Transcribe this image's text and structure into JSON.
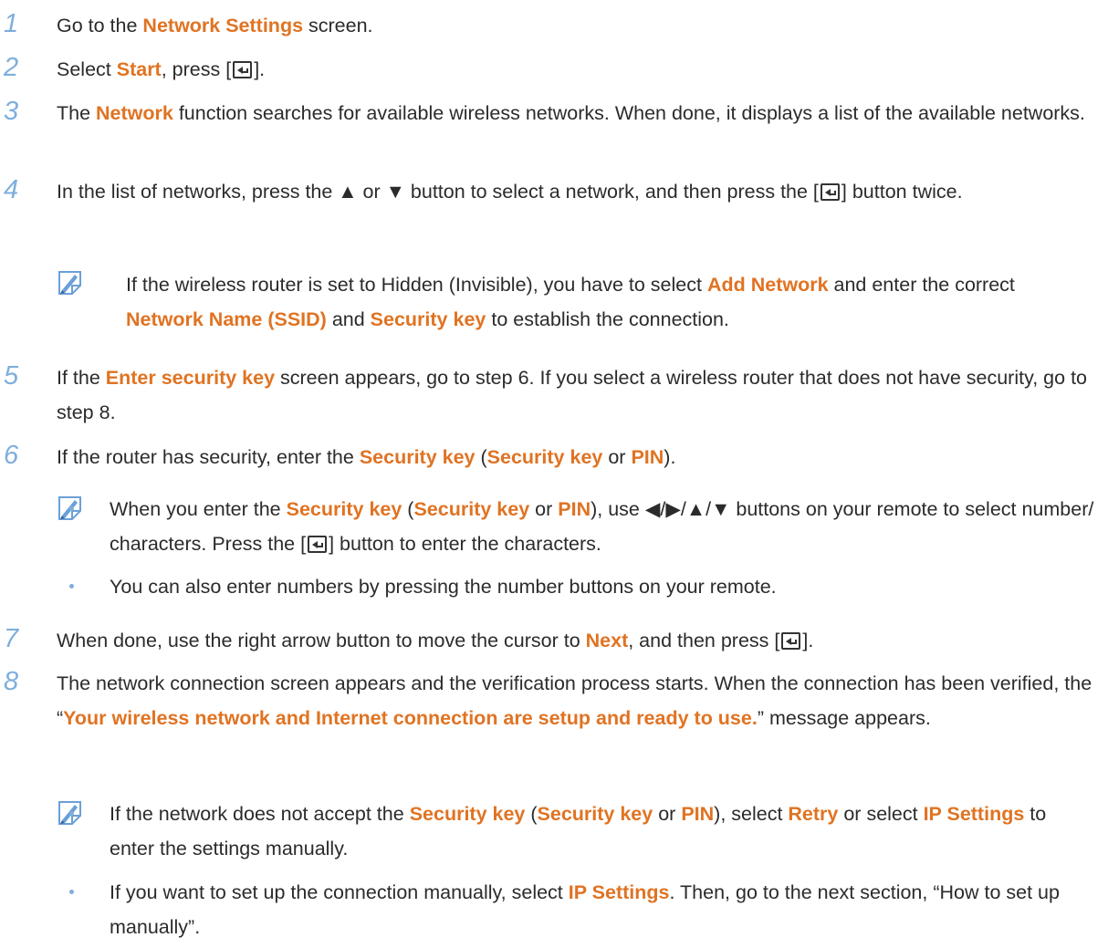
{
  "steps": [
    {
      "num": "1",
      "a": "Go to the ",
      "h1": "Network Settings",
      "b": " screen."
    },
    {
      "num": "2",
      "a": "Select ",
      "h1": "Start",
      "b": ", press [",
      "c": "]."
    },
    {
      "num": "3",
      "a": "The ",
      "h1": "Network",
      "b": " function searches for available wireless networks. When done, it displays a list of the available networks."
    },
    {
      "num": "4",
      "a": "In the list of networks, press the ▲ or ▼ button to select a network, and then press the [",
      "b": "] button twice."
    },
    {
      "num": "5",
      "a": "If the ",
      "h1": "Enter security key",
      "b": " screen appears, go to step 6. If you select a wireless router that does not have security, go to step 8."
    },
    {
      "num": "6",
      "a": "If the router has security, enter the ",
      "h1": "Security key",
      "b": " (",
      "h2": "Security key",
      "c": " or ",
      "h3": "PIN",
      "d": ")."
    },
    {
      "num": "7",
      "a": "When done, use the right arrow button to move the cursor to ",
      "h1": "Next",
      "b": ", and then press [",
      "c": "]."
    },
    {
      "num": "8",
      "a": "The network connection screen appears and the verification process starts. When the connection has been verified, the “",
      "h1": "Your wireless network and Internet connection are setup and ready to use.",
      "b": "” message appears."
    }
  ],
  "note4": {
    "a": "If the wireless router is set to Hidden (Invisible), you have to select ",
    "h1": "Add Network",
    "b": " and enter the correct ",
    "h2": "Network Name (SSID)",
    "c": " and ",
    "h3": "Security key",
    "d": " to establish the connection."
  },
  "note6": [
    {
      "a": "When you enter the ",
      "h1": "Security key",
      "b": " (",
      "h2": "Security key",
      "c": " or ",
      "h3": "PIN",
      "d": "), use ◀/▶/▲/▼ buttons on your remote to select number/ characters. Press the [",
      "e": "] button to enter the characters."
    },
    {
      "a": "You can also enter numbers by pressing the number buttons on your remote."
    }
  ],
  "note8": [
    {
      "a": "If the network does not accept the ",
      "h1": "Security key",
      "b": " (",
      "h2": "Security key",
      "c": " or ",
      "h3": "PIN",
      "d": "), select ",
      "h4": "Retry",
      "e": " or select ",
      "h5": "IP Settings",
      "f": " to enter the settings manually."
    },
    {
      "a": "If you want to set up the connection manually, select ",
      "h1": "IP Settings",
      "b": ". Then, go to the next section, “How to set up manually”."
    }
  ],
  "icons": {
    "note": "note-pencil-icon",
    "enter": "enter-key-icon",
    "bullet": "bullet-dot"
  },
  "colors": {
    "highlight": "#e07322",
    "step_number": "#7eaedc",
    "text": "#2b2b2b"
  }
}
